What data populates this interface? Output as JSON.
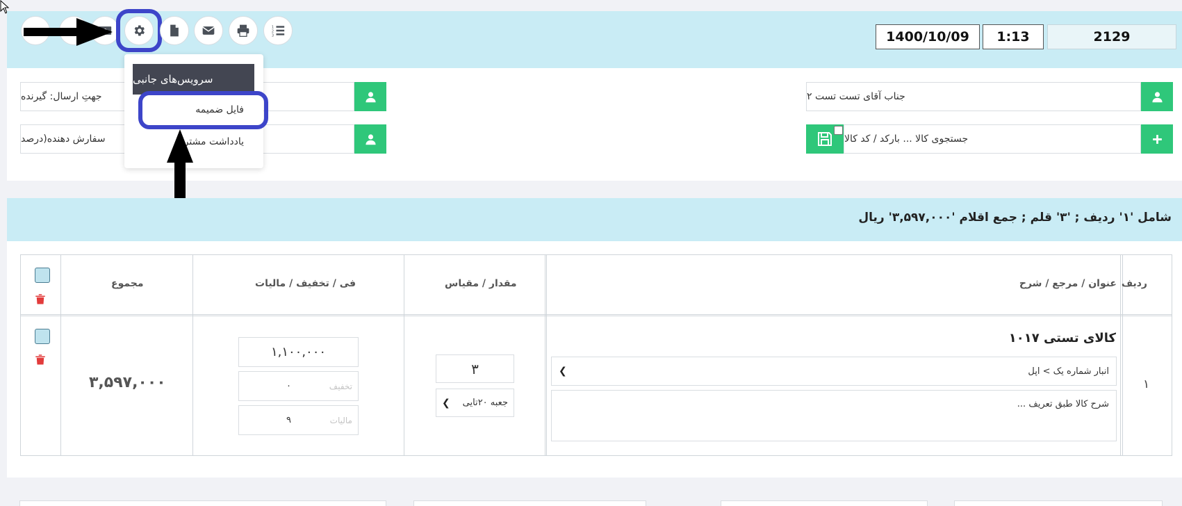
{
  "toolbar": {
    "buttons": [
      {
        "name": "list-numbered-icon"
      },
      {
        "name": "print-icon"
      },
      {
        "name": "envelope-icon"
      },
      {
        "name": "file-icon"
      },
      {
        "name": "gear-icon"
      },
      {
        "name": "money-icon"
      }
    ],
    "date": "1400/10/09",
    "time": "1:13",
    "code": "2129"
  },
  "form": {
    "recipient_value": "جناب آقای تست تست ۲",
    "product_search_placeholder": "جستجوی کالا ... بارکد / کد کالا",
    "send_to_label": "جهتِ ارسال: گیرنده",
    "orderer_label": "سفارش دهنده(درصد"
  },
  "dropdown": {
    "header": "سرویس‌های جانبی",
    "items": [
      "فایل ضمیمه",
      "یادداشت مشتری"
    ]
  },
  "summary": {
    "text": "شامل '۱' ردیف ; '۳' قلم ; جمع اقلام '۳,۵۹۷,۰۰۰' ریال"
  },
  "table": {
    "headers": {
      "row": "ردیف",
      "title": "عنوان / مرجع / شرح",
      "qty": "مقدار / مقیاس",
      "price": "فی / تخفیف / مالیات",
      "total": "مجموع"
    },
    "rows": [
      {
        "row_number": "۱",
        "product_title": "کالای تستی ۱۰۱۷",
        "warehouse": "انبار شماره یک > اپل",
        "description": "شرح کالا طبق تعریف ...",
        "quantity": "۳",
        "unit": "جعبه ۲۰تایی",
        "price": "۱,۱۰۰,۰۰۰",
        "discount_label": "تخفیف",
        "discount": "۰",
        "tax_label": "مالیات",
        "tax": "۹",
        "total": "۳,۵۹۷,۰۰۰"
      }
    ]
  },
  "colors": {
    "band": "#c9ecf5",
    "green": "#2fc77a",
    "highlight": "#3d45c9",
    "trash": "#e23b3b"
  }
}
